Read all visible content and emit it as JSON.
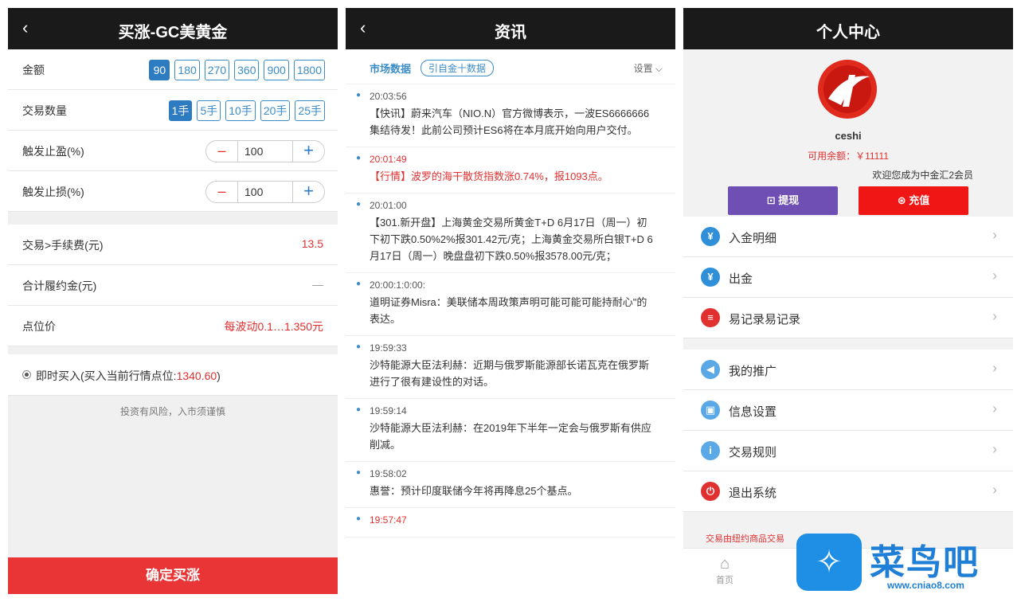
{
  "buy_panel": {
    "title": "买涨-GC美黄金",
    "amount_label": "金额",
    "amount_options": [
      "90",
      "180",
      "270",
      "360",
      "900",
      "1800"
    ],
    "amount_selected": "90",
    "qty_label": "交易数量",
    "qty_options": [
      "1手",
      "5手",
      "10手",
      "20手",
      "25手"
    ],
    "qty_selected": "1手",
    "take_profit_label": "触发止盈(%)",
    "take_profit_value": "100",
    "stop_loss_label": "触发止损(%)",
    "stop_loss_value": "100",
    "minus_symbol": "–",
    "plus_symbol": "+",
    "fee_label": "交易>手续费(元)",
    "fee_value": "13.5",
    "margin_label": "合计履约金(元)",
    "margin_value": "—",
    "point_label": "点位价",
    "point_value": "每波动0.1…1.350元",
    "buy_now_label": "即时买入(买入当前行情点位:",
    "buy_now_price": "1340.60",
    "buy_now_suffix": ")",
    "risk_text": "投资有风险，入市须谨慎",
    "confirm_label": "确定买涨"
  },
  "news_panel": {
    "title": "资讯",
    "tab_label": "市场数据",
    "chip_label": "引自金十数据",
    "settings_label": "设置 ⌵",
    "items": [
      {
        "time": "20:03:56",
        "text": "【快讯】蔚来汽车（NIO.N）官方微博表示，一波ES6666666集结待发！此前公司预计ES6将在本月底开始向用户交付。",
        "red": false
      },
      {
        "time": "20:01:49",
        "text": "【行情】波罗的海干散货指数涨0.74%，报1093点。",
        "red": true
      },
      {
        "time": "20:01:00",
        "text": "【301.新开盘】上海黄金交易所黄金T+D 6月17日（周一）初下初下跌0.50%2%报301.42元/克；上海黄金交易所白银T+D 6月17日（周一）晚盘盘初下跌0.50%报3578.00元/克；",
        "red": false
      },
      {
        "time": "20:00:1:0:00:",
        "text": "道明证券Misra：美联储本周政策声明可能可能可能持耐心\"的表达。",
        "red": false
      },
      {
        "time": "19:59:33",
        "text": "沙特能源大臣法利赫：近期与俄罗斯能源部长诺瓦克在俄罗斯进行了很有建设性的对话。",
        "red": false
      },
      {
        "time": "19:59:14",
        "text": "沙特能源大臣法利赫：在2019年下半年一定会与俄罗斯有供应削减。",
        "red": false
      },
      {
        "time": "19:58:02",
        "text": "惠誉：预计印度联储今年将再降息25个基点。",
        "red": false
      },
      {
        "time": "19:57:47",
        "text": "",
        "red": true
      }
    ]
  },
  "profile_panel": {
    "title": "个人中心",
    "username": "ceshi",
    "balance": "可用余额：￥11111",
    "welcome": "欢迎您成为中金汇2会员",
    "withdraw_label": "⊡ 提现",
    "recharge_label": "⊛ 充值",
    "menu_a": [
      {
        "label": "入金明细",
        "icon": "deposit-icon",
        "color": "#2f8fd8"
      },
      {
        "label": "出金",
        "icon": "withdraw-icon",
        "color": "#2f8fd8"
      },
      {
        "label": "易记录易记录",
        "icon": "record-icon",
        "color": "#e03030"
      }
    ],
    "menu_b": [
      {
        "label": "我的推广",
        "icon": "megaphone-icon",
        "color": "#5aa9e6"
      },
      {
        "label": "信息设置",
        "icon": "settings-icon",
        "color": "#5aa9e6"
      },
      {
        "label": "交易规则",
        "icon": "info-icon",
        "color": "#5aa9e6"
      },
      {
        "label": "退出系统",
        "icon": "power-icon",
        "color": "#e03030"
      }
    ],
    "notice": "交易由纽约商品交易",
    "tab_home": "首页"
  },
  "watermark": {
    "brand": "菜鸟吧",
    "url": "www.cniao8.com"
  }
}
